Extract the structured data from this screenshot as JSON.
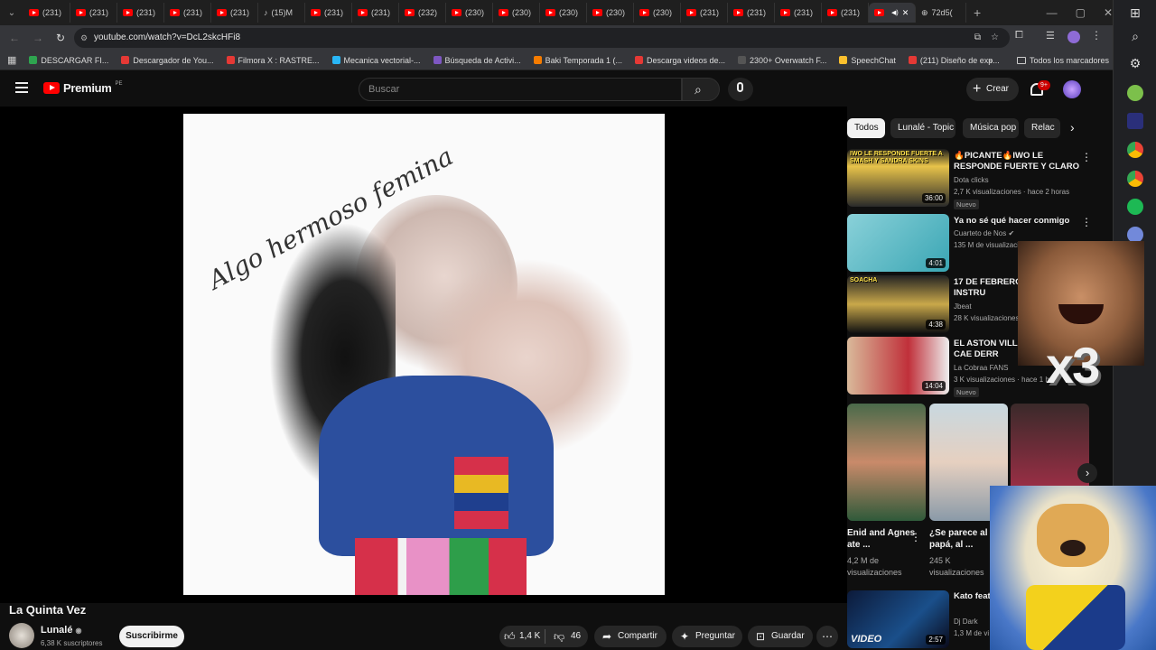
{
  "browser": {
    "tabs": [
      {
        "label": "(231)"
      },
      {
        "label": "(231)"
      },
      {
        "label": "(231)"
      },
      {
        "label": "(231)"
      },
      {
        "label": "(231)"
      },
      {
        "label": "(15)M"
      },
      {
        "label": "(231)"
      },
      {
        "label": "(231)"
      },
      {
        "label": "(232)"
      },
      {
        "label": "(230)"
      },
      {
        "label": "(230)"
      },
      {
        "label": "(230)"
      },
      {
        "label": "(230)"
      },
      {
        "label": "(230)"
      },
      {
        "label": "(231)"
      },
      {
        "label": "(231)"
      },
      {
        "label": "(231)"
      },
      {
        "label": "(231)"
      },
      {
        "label": ""
      },
      {
        "label": "72d5("
      }
    ],
    "url": "youtube.com/watch?v=DcL2skcHFi8",
    "bookmarks": [
      {
        "label": "DESCARGAR FI...",
        "color": "#2ea44f"
      },
      {
        "label": "Descargador de You...",
        "color": "#e53935"
      },
      {
        "label": "Filmora X : RASTRE...",
        "color": "#e53935"
      },
      {
        "label": "Mecanica vectorial-...",
        "color": "#29b6f6"
      },
      {
        "label": "Búsqueda de Activi...",
        "color": "#7e57c2"
      },
      {
        "label": "Baki Temporada 1 (...",
        "color": "#f57c00"
      },
      {
        "label": "Descarga videos de...",
        "color": "#e53935"
      },
      {
        "label": "2300+ Overwatch F...",
        "color": "#555555"
      },
      {
        "label": "SpeechChat",
        "color": "#fbc02d"
      },
      {
        "label": "(211) Diseño de exp...",
        "color": "#e53935"
      }
    ],
    "all_bookmarks": "Todos los marcadores"
  },
  "header": {
    "logo_text": "Premium",
    "logo_badge": "PE",
    "search_placeholder": "Buscar",
    "create_label": "Crear",
    "notif_count": "9+"
  },
  "video": {
    "overlay_text": "Algo hermoso femina",
    "title": "La Quinta Vez",
    "channel": "Lunalé",
    "subscribers": "6,38 K suscriptores",
    "subscribe_label": "Suscribirme",
    "likes": "1,4 K",
    "dislikes": "46",
    "share_label": "Compartir",
    "ask_label": "Preguntar",
    "save_label": "Guardar"
  },
  "sidebar": {
    "chips": [
      {
        "label": "Todos",
        "active": true
      },
      {
        "label": "Lunalé - Topic"
      },
      {
        "label": "Música pop"
      },
      {
        "label": "Relac"
      }
    ],
    "videos": [
      {
        "title": "🔥PICANTE🔥IWO LE RESPONDE FUERTE Y CLARO ...",
        "channel": "Dota clicks",
        "meta": "2,7 K visualizaciones · hace 2 horas",
        "badge": "Nuevo",
        "duration": "36:00",
        "thumb_text": "IWO LE RESPONDE FUERTE A SMASH Y SANDRA SKINS"
      },
      {
        "title": "Ya no sé qué hacer conmigo",
        "channel": "Cuarteto de Nos ✔",
        "meta": "135 M de visualizaciones",
        "badge": "",
        "duration": "4:01",
        "thumb_text": ""
      },
      {
        "title": "17 DE FEBRERO - VALLEST INSTRU",
        "channel": "Jbeat",
        "meta": "28 K visualizaciones",
        "badge": "",
        "duration": "4:38",
        "thumb_text": "SOACHA"
      },
      {
        "title": "EL ASTON VILLA ... EMERY CAE DERR",
        "channel": "La Cobraa FANS",
        "meta": "3 K visualizaciones · hace 1 h",
        "badge": "Nuevo",
        "duration": "14:04",
        "thumb_text": ""
      }
    ],
    "shorts": [
      {
        "title": "Enid and Agnes ate ...",
        "meta": "4,2 M de visualizaciones"
      },
      {
        "title": "¿Se parece al papá, al ...",
        "meta": "245 K visualizaciones"
      }
    ],
    "last_video": {
      "title": "Kato feat Off (Dj De",
      "channel": "Dj Dark",
      "meta": "1,3 M de vi",
      "duration": "2:57",
      "thumb_text": "VIDEO"
    }
  },
  "overlays": {
    "sticker_text": "x3"
  }
}
